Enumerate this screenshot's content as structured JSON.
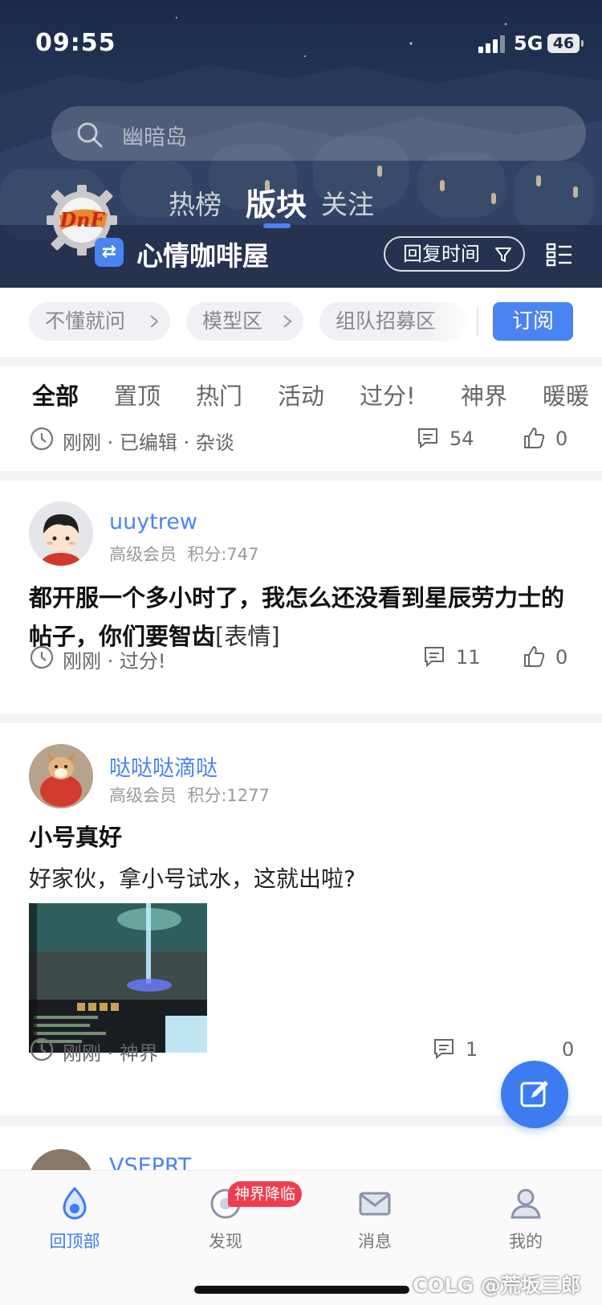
{
  "status_bar": {
    "time": "09:55",
    "network": "5G",
    "battery": "46"
  },
  "search": {
    "placeholder": "幽暗岛"
  },
  "header": {
    "tabs": [
      {
        "label": "热榜",
        "active": false
      },
      {
        "label": "版块",
        "active": true
      },
      {
        "label": "关注",
        "active": false
      }
    ],
    "board_name": "心情咖啡屋",
    "sort_label": "回复时间",
    "switch_icon": "swap-icon",
    "logo_icon": "dnf-gear-logo"
  },
  "sub_boards": {
    "items": [
      {
        "label": "不懂就问"
      },
      {
        "label": "模型区"
      },
      {
        "label": "组队招募区"
      }
    ],
    "subscribe_label": "订阅"
  },
  "categories": [
    "全部",
    "置顶",
    "热门",
    "活动",
    "过分!",
    "神界",
    "暖暖"
  ],
  "posts": [
    {
      "meta": "刚刚 · 已编辑 · 杂谈",
      "comments": "54",
      "likes": "0"
    },
    {
      "username": "uuytrew",
      "level": "高级会员",
      "points": "积分:747",
      "title": "都开服一个多小时了，我怎么还没看到星辰劳力士的帖子，你们要智齿",
      "emote": "[表情]",
      "meta": "刚刚 · 过分!",
      "comments": "11",
      "likes": "0"
    },
    {
      "username": "哒哒哒滴哒",
      "level": "高级会员",
      "points": "积分:1277",
      "title": "小号真好",
      "body": "好家伙，拿小号试水，这就出啦?",
      "meta": "刚刚 · 神界",
      "comments": "1",
      "likes": "0"
    },
    {
      "username": "VSEPRT"
    }
  ],
  "bottom_nav": {
    "items": [
      {
        "label": "回顶部",
        "icon": "back-to-top-icon",
        "active": true
      },
      {
        "label": "发现",
        "icon": "discover-icon",
        "active": false
      },
      {
        "label": "消息",
        "icon": "mail-icon",
        "active": false
      },
      {
        "label": "我的",
        "icon": "profile-icon",
        "active": false
      }
    ],
    "discover_badge": "神界降临"
  },
  "watermark": "COLG @荒坂三郎",
  "colors": {
    "accent": "#4a84f2",
    "badge_red": "#ee3e4e",
    "username_blue": "#4a84f2"
  }
}
